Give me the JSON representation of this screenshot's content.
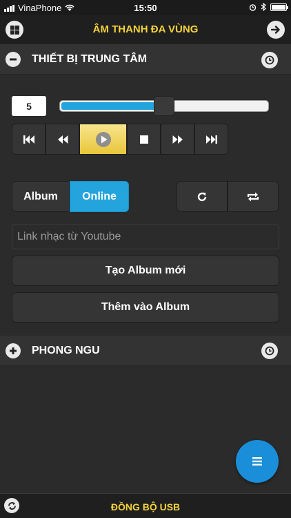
{
  "status_bar": {
    "carrier": "VinaPhone",
    "time": "15:50"
  },
  "header": {
    "title": "ÂM THANH ĐA VÙNG",
    "left_icon": "windows-icon",
    "right_icon": "arrow-right-icon"
  },
  "zone_main": {
    "title": "THIẾT BỊ TRUNG TÂM",
    "toggle_icon": "minus-icon",
    "timer_icon": "clock-icon",
    "volume": "5",
    "volume_level": 0.5,
    "controls": [
      "skip-previous",
      "rewind",
      "play",
      "stop",
      "fast-forward",
      "skip-next"
    ],
    "active_control": "play",
    "source_tabs": [
      "Album",
      "Online"
    ],
    "active_source": "Online",
    "repeat_buttons": [
      "refresh-icon",
      "repeat-icon"
    ],
    "link_placeholder": "Link nhạc từ Youtube",
    "create_album_label": "Tạo Album mới",
    "add_to_album_label": "Thêm vào Album"
  },
  "zone_second": {
    "title": "PHONG NGU",
    "toggle_icon": "plus-icon",
    "timer_icon": "clock-icon"
  },
  "fab_icon": "menu-icon",
  "bottom_bar": {
    "label": "ĐỒNG BỘ USB",
    "icon": "sync-icon"
  },
  "colors": {
    "accent_yellow": "#f5d33c",
    "accent_blue": "#24a4dd",
    "fab_blue": "#1a8ed8"
  }
}
